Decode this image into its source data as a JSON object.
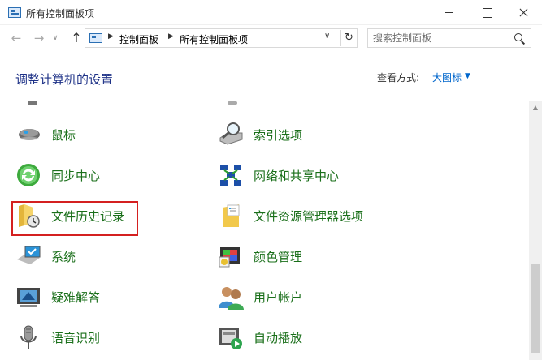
{
  "window": {
    "title": "所有控制面板项"
  },
  "nav": {
    "back_icon": "arrow-left-icon",
    "forward_icon": "arrow-right-icon",
    "up_icon": "arrow-up-icon",
    "breadcrumbs": [
      "控制面板",
      "所有控制面板项"
    ],
    "search_placeholder": "搜索控制面板"
  },
  "header": {
    "title": "调整计算机的设置",
    "view_label": "查看方式:",
    "view_value": "大图标"
  },
  "items": [
    {
      "label": "鼠标",
      "icon": "mouse-icon"
    },
    {
      "label": "索引选项",
      "icon": "indexing-options-icon"
    },
    {
      "label": "同步中心",
      "icon": "sync-center-icon"
    },
    {
      "label": "网络和共享中心",
      "icon": "network-sharing-icon"
    },
    {
      "label": "文件历史记录",
      "icon": "file-history-icon"
    },
    {
      "label": "文件资源管理器选项",
      "icon": "file-explorer-options-icon"
    },
    {
      "label": "系统",
      "icon": "system-icon"
    },
    {
      "label": "颜色管理",
      "icon": "color-management-icon"
    },
    {
      "label": "疑难解答",
      "icon": "troubleshooting-icon"
    },
    {
      "label": "用户帐户",
      "icon": "user-accounts-icon"
    },
    {
      "label": "语音识别",
      "icon": "speech-recognition-icon"
    },
    {
      "label": "自动播放",
      "icon": "autoplay-icon"
    }
  ],
  "colors": {
    "link_green": "#1a6f1a",
    "title_blue": "#1e3287",
    "accent_blue": "#0066cc",
    "highlight_red": "#d42020"
  }
}
